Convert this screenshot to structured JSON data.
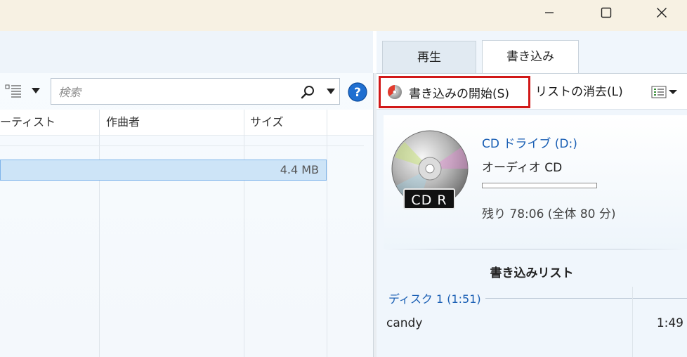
{
  "window": {
    "minimize_icon": "minimize-icon",
    "maximize_icon": "maximize-icon",
    "close_icon": "close-icon"
  },
  "library": {
    "search": {
      "placeholder": "検索"
    },
    "columns": [
      "ーティスト",
      "作曲者",
      "サイズ"
    ],
    "selected_row": {
      "size": "4.4 MB"
    }
  },
  "tabs": [
    {
      "label": "再生",
      "active": false
    },
    {
      "label": "書き込み",
      "active": true
    }
  ],
  "burn_toolbar": {
    "start_burn": "書き込みの開始(S)",
    "clear_list": "リストの消去(L)"
  },
  "drive": {
    "name": "CD ドライブ (D:)",
    "badge": "CD R",
    "disc_type": "オーディオ CD",
    "capacity_used_fraction": 0.0,
    "remaining": "残り 78:06 (全体 80 分)"
  },
  "burn_list": {
    "title": "書き込みリスト",
    "disc": "ディスク 1 (1:51)",
    "tracks": [
      {
        "name": "candy",
        "duration": "1:49"
      }
    ]
  },
  "colors": {
    "highlight_border": "#d11818",
    "link_blue": "#1a5fb4",
    "selection_bg": "#cde4f7"
  }
}
